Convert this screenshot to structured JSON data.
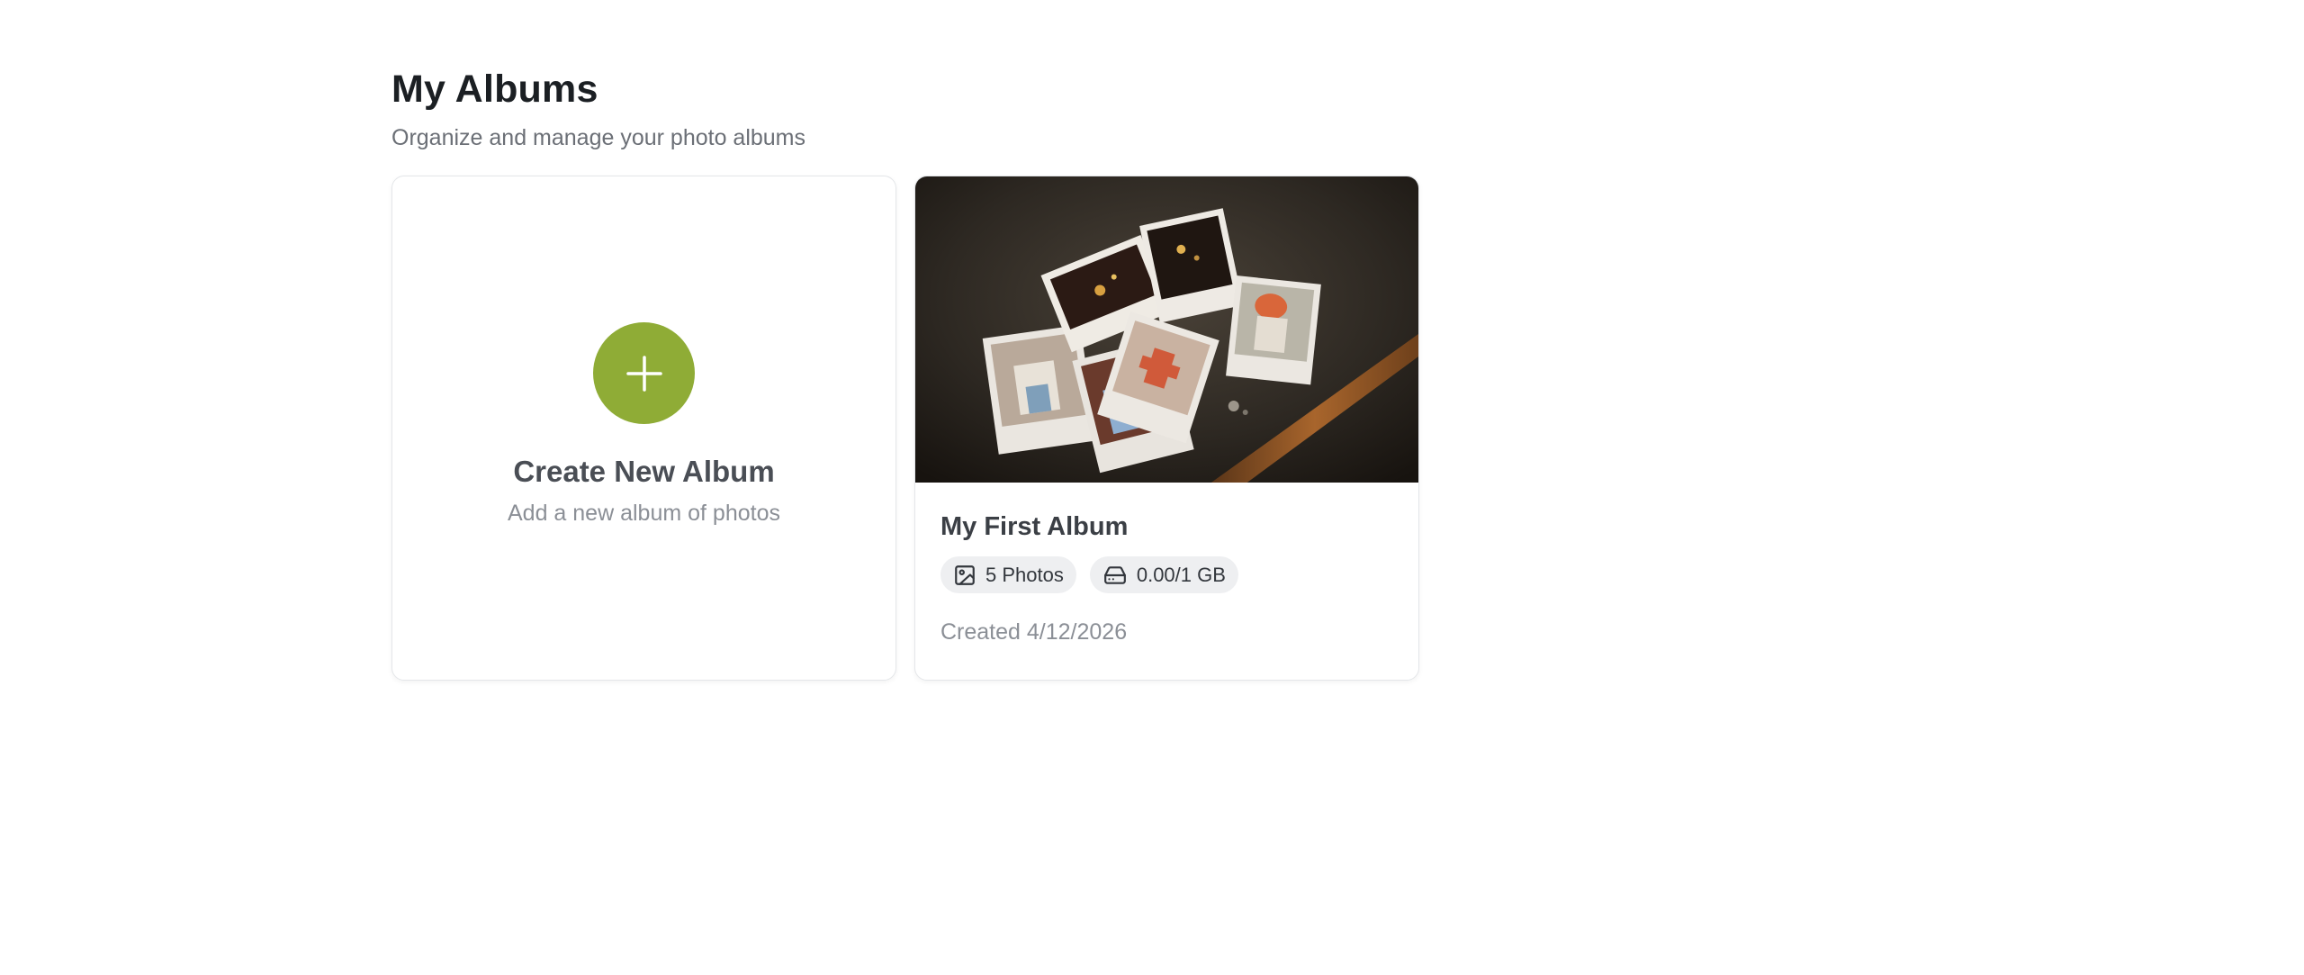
{
  "header": {
    "title": "My Albums",
    "subtitle": "Organize and manage your photo albums"
  },
  "create_card": {
    "icon": "plus-icon",
    "title": "Create New Album",
    "subtitle": "Add a new album of photos",
    "accent_color": "#8fac36"
  },
  "albums": [
    {
      "name": "My First Album",
      "photos_label": "5 Photos",
      "storage_label": "0.00/1 GB",
      "created_label": "Created 4/12/2026",
      "cover": "scattered-instant-photos"
    }
  ]
}
